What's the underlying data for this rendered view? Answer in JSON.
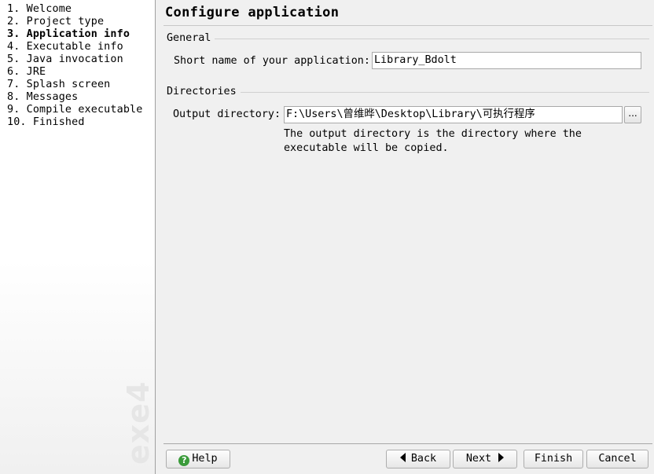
{
  "sidebar": {
    "steps": [
      {
        "label": "1. Welcome"
      },
      {
        "label": "2. Project type"
      },
      {
        "label": "3. Application info",
        "active": true
      },
      {
        "label": "4. Executable info"
      },
      {
        "label": "5. Java invocation"
      },
      {
        "label": "6. JRE"
      },
      {
        "label": "7. Splash screen"
      },
      {
        "label": "8. Messages"
      },
      {
        "label": "9. Compile executable"
      },
      {
        "label": "10. Finished"
      }
    ],
    "watermark": "exe4j"
  },
  "main": {
    "title": "Configure application",
    "general": {
      "heading": "General",
      "short_name_label": "Short name of your application:",
      "short_name_value": "Library_Bdolt"
    },
    "directories": {
      "heading": "Directories",
      "output_label": "Output directory:",
      "output_value": "F:\\Users\\曾维晔\\Desktop\\Library\\可执行程序",
      "browse_label": "...",
      "help_text": "The output directory is the directory where the executable will be copied."
    }
  },
  "footer": {
    "help_label": "Help",
    "back_label": "Back",
    "next_label": "Next",
    "finish_label": "Finish",
    "cancel_label": "Cancel"
  },
  "colors": {
    "help_icon": "#3a9b3a",
    "window_bg": "#f0f0f0",
    "sidebar_bg": "#ffffff"
  },
  "icons": {
    "help": "question-circle-icon",
    "back": "triangle-left-icon",
    "next": "triangle-right-icon"
  }
}
